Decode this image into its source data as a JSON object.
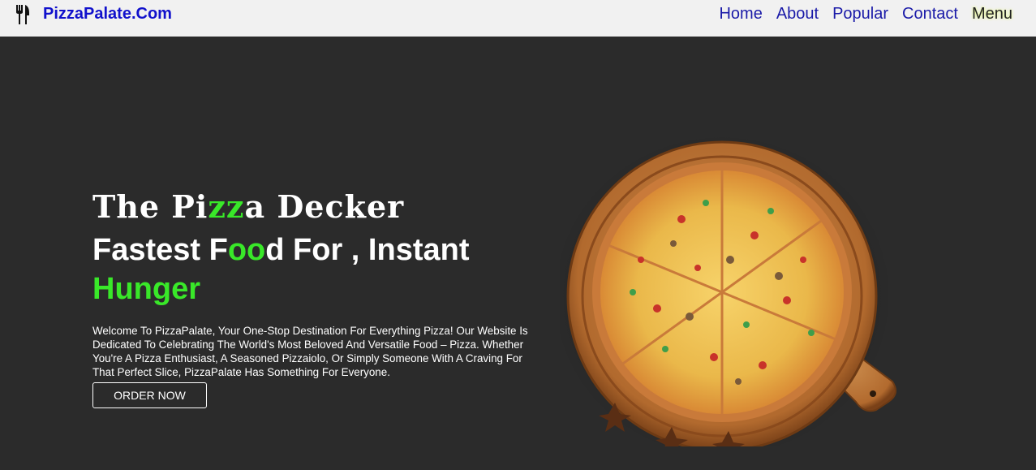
{
  "navbar": {
    "brand": "PizzaPalate.Com",
    "brand_icon": "utensils-icon",
    "links": [
      "Home",
      "About",
      "Popular",
      "Contact",
      "Menu"
    ]
  },
  "hero": {
    "tagline_parts": [
      "The Pi",
      "zz",
      "a Decker"
    ],
    "headline_parts": [
      "Fastest F",
      "oo",
      "d For , Instant",
      "Hunger"
    ],
    "description": "Welcome To PizzaPalate, Your One-Stop Destination For Everything Pizza! Our Website Is Dedicated To Celebrating The World's Most Beloved And Versatile Food – Pizza. Whether You're A Pizza Enthusiast, A Seasoned Pizzaiolo, Or Simply Someone With A Craving For That Perfect Slice, PizzaPalate Has Something For Everyone.",
    "cta": "ORDER NOW",
    "image_icon": "pizza-on-board-image"
  },
  "colors": {
    "accent_green": "#39e829",
    "brand_blue": "#1111cc",
    "background_dark": "#2b2b2b",
    "navbar_bg": "#f1f1f1"
  }
}
